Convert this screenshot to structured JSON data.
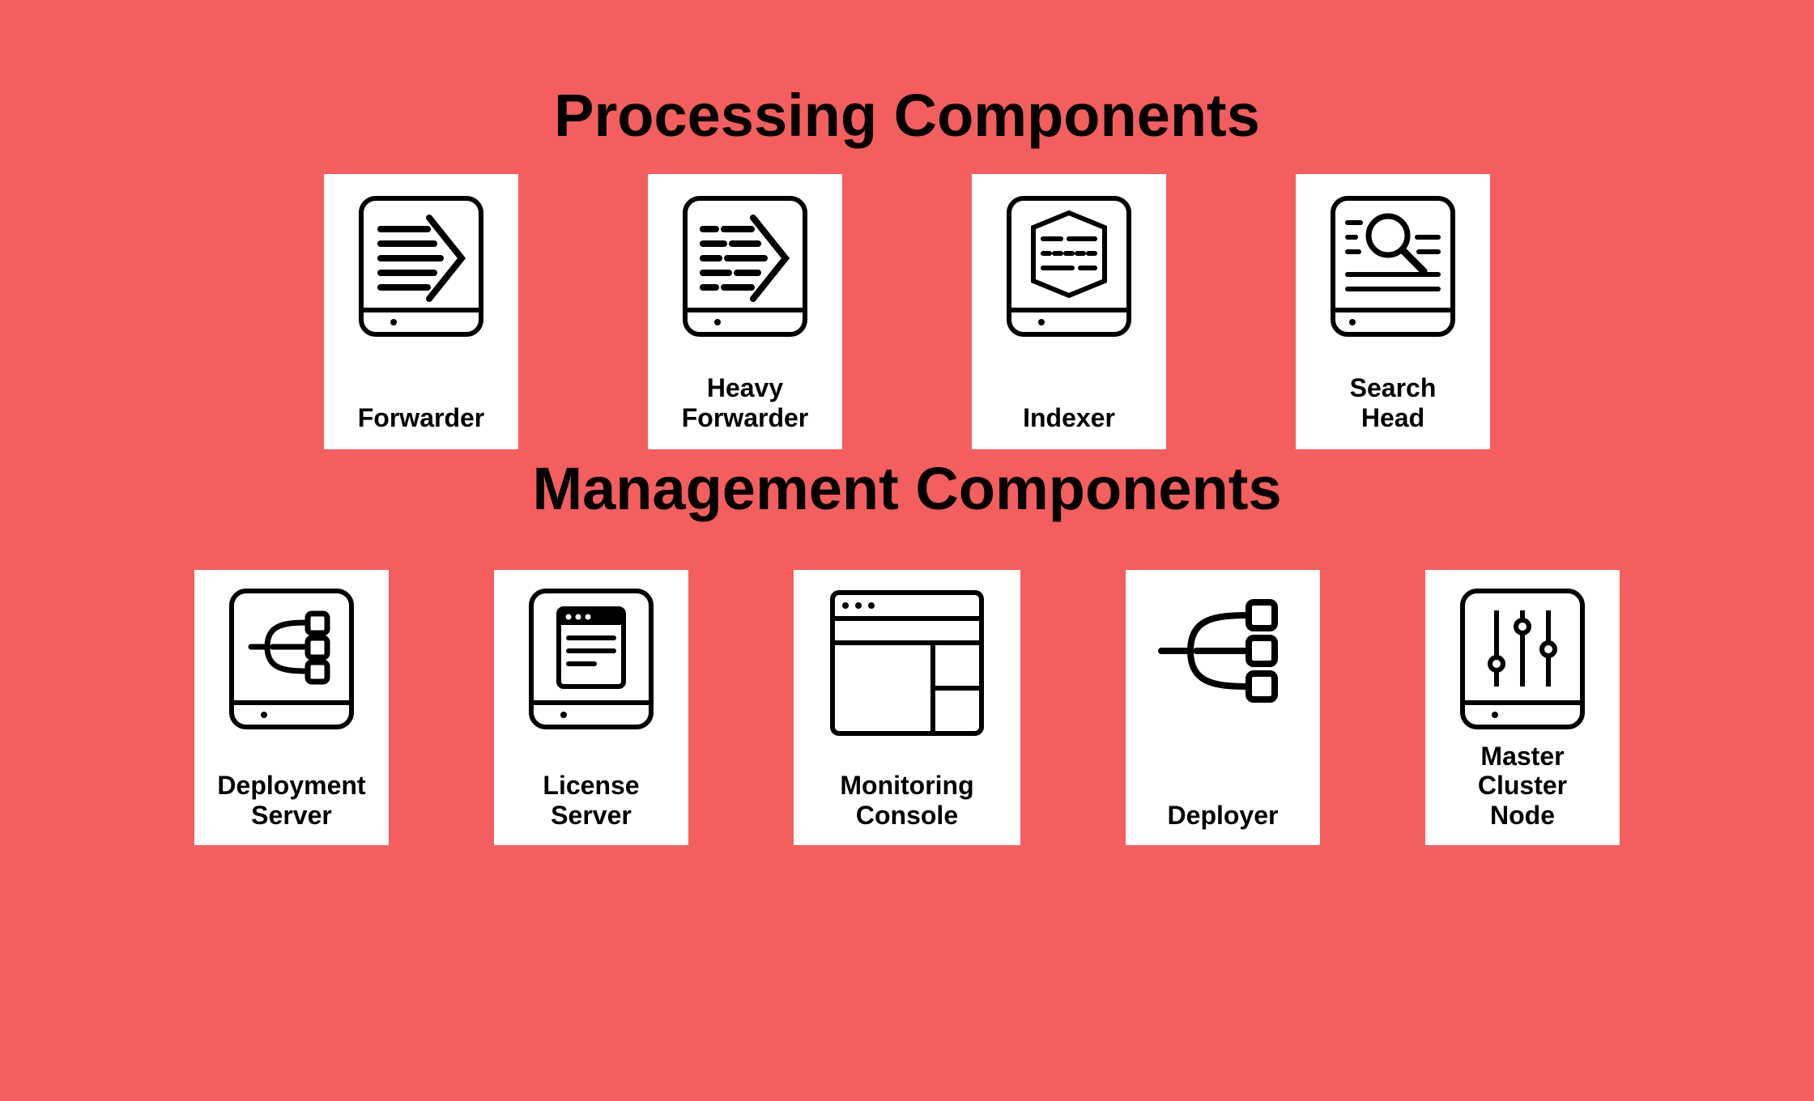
{
  "sections": {
    "processing": {
      "title": "Processing Components",
      "cards": [
        {
          "label": "Forwarder",
          "icon": "forwarder-icon"
        },
        {
          "label": "Heavy\nForwarder",
          "icon": "heavy-forwarder-icon"
        },
        {
          "label": "Indexer",
          "icon": "indexer-icon"
        },
        {
          "label": "Search\nHead",
          "icon": "search-head-icon"
        }
      ]
    },
    "management": {
      "title": "Management Components",
      "cards": [
        {
          "label": "Deployment\nServer",
          "icon": "deployment-server-icon"
        },
        {
          "label": "License\nServer",
          "icon": "license-server-icon"
        },
        {
          "label": "Monitoring\nConsole",
          "icon": "monitoring-console-icon"
        },
        {
          "label": "Deployer",
          "icon": "deployer-icon"
        },
        {
          "label": "Master Cluster\nNode",
          "icon": "master-cluster-node-icon"
        }
      ]
    }
  },
  "colors": {
    "background": "#f45e5e",
    "card": "#ffffff",
    "text": "#000000"
  }
}
